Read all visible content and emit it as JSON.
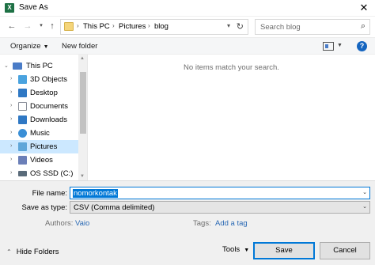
{
  "window": {
    "title": "Save As",
    "app_icon": "X"
  },
  "nav": {
    "breadcrumb": [
      "This PC",
      "Pictures",
      "blog"
    ],
    "search_placeholder": "Search blog"
  },
  "toolbar": {
    "organize_label": "Organize",
    "new_folder_label": "New folder",
    "help_label": "?"
  },
  "sidebar": {
    "items": [
      {
        "label": "This PC",
        "icon": "pc-icon",
        "color": "#4a7cc7",
        "expanded": true
      },
      {
        "label": "3D Objects",
        "icon": "cube-icon",
        "color": "#4aa3df"
      },
      {
        "label": "Desktop",
        "icon": "desktop-icon",
        "color": "#2f78c4"
      },
      {
        "label": "Documents",
        "icon": "document-icon",
        "color": "#8a8f99"
      },
      {
        "label": "Downloads",
        "icon": "download-icon",
        "color": "#2f78c4"
      },
      {
        "label": "Music",
        "icon": "music-icon",
        "color": "#3a8fd6"
      },
      {
        "label": "Pictures",
        "icon": "pictures-icon",
        "color": "#5fa6d9",
        "selected": true
      },
      {
        "label": "Videos",
        "icon": "video-icon",
        "color": "#6b7fb8"
      },
      {
        "label": "OS SSD (C:)",
        "icon": "drive-icon",
        "color": "#5a6b7a"
      }
    ]
  },
  "content": {
    "empty_message": "No items match your search."
  },
  "form": {
    "filename_label": "File name:",
    "filename_value": "nomorkontak",
    "savetype_label": "Save as type:",
    "savetype_value": "CSV (Comma delimited)",
    "authors_label": "Authors:",
    "authors_value": "Vaio",
    "tags_label": "Tags:",
    "tags_value": "Add a tag"
  },
  "footer": {
    "hide_folders_label": "Hide Folders",
    "tools_label": "Tools",
    "save_label": "Save",
    "cancel_label": "Cancel"
  },
  "colors": {
    "accent": "#0078d7",
    "selection": "#cce8ff",
    "link": "#2b6ab5"
  }
}
